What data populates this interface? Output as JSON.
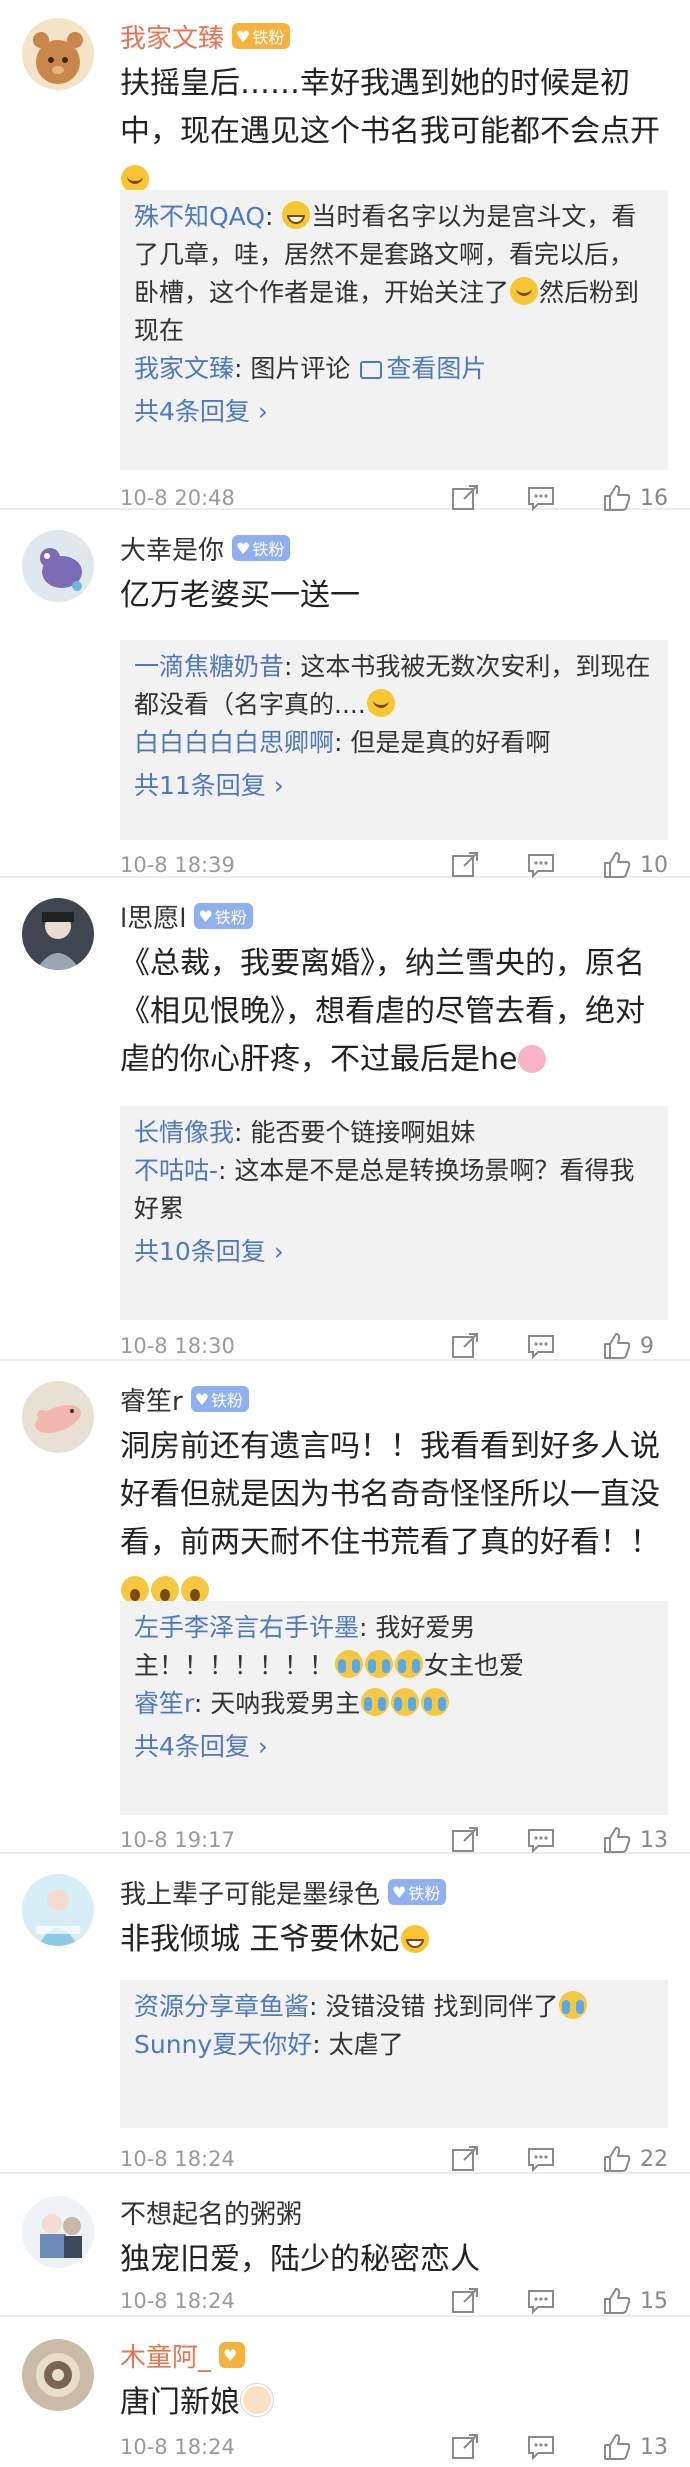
{
  "comments": [
    {
      "name": "我家文臻",
      "name_vip": true,
      "badge": "铁粉",
      "badge_style": "gold",
      "text_parts": [
        "扶摇皇后……幸好我遇到她的时候是初中，现在遇见这个书名我可能都不会点开"
      ],
      "emoji_end": "sweat",
      "replies": [
        {
          "name": "殊不知QAQ",
          "text": "当时看名字以为是宫斗文，看了几章，哇，居然不是套路文啊，看完以后，卧槽，这个作者是谁，开始关注了",
          "text2": "然后粉到现在"
        },
        {
          "name": "我家文臻",
          "text": "图片评论",
          "link": "查看图片"
        }
      ],
      "more": "共4条回复 ›",
      "time": "10-8 20:48",
      "likes": "16"
    },
    {
      "name": "大幸是你",
      "name_vip": false,
      "badge": "铁粉",
      "badge_style": "fan",
      "text_parts": [
        "亿万老婆买一送一"
      ],
      "replies": [
        {
          "name": "一滴焦糖奶昔",
          "text": "这本书我被无数次安利，到现在都没看（名字真的...."
        },
        {
          "name": "白白白白白思卿啊",
          "text": "但是是真的好看啊"
        }
      ],
      "more": "共11条回复 ›",
      "time": "10-8 18:39",
      "likes": "10"
    },
    {
      "name": "l思愿l",
      "name_vip": false,
      "badge": "铁粉",
      "badge_style": "fan",
      "text_parts": [
        "《总裁，我要离婚》，纳兰雪央的，原名《相见恨晚》，想看虐的尽管去看，绝对虐的你心肝疼，不过最后是he"
      ],
      "emoji_end": "pig",
      "replies": [
        {
          "name": "长情像我",
          "text": "能否要个链接啊姐妹"
        },
        {
          "name": "不咕咕-",
          "text": "这本是不是总是转换场景啊？看得我好累"
        }
      ],
      "more": "共10条回复 ›",
      "time": "10-8 18:30",
      "likes": "9"
    },
    {
      "name": "睿笙r",
      "name_vip": false,
      "badge": "铁粉",
      "badge_style": "fan",
      "text_parts": [
        "洞房前还有遗言吗！！我看看到好多人说好看但就是因为书名奇奇怪怪所以一直没看，前两天耐不住书荒看了真的好看！！"
      ],
      "emoji_end": "shock3",
      "replies": [
        {
          "name": "左手李泽言右手许墨",
          "text": "我好爱男主！！！！！！！",
          "text_after": "女主也爱"
        },
        {
          "name": "睿笙r",
          "text": "天呐我爱男主"
        }
      ],
      "more": "共4条回复 ›",
      "time": "10-8 19:17",
      "likes": "13"
    },
    {
      "name": "我上辈子可能是墨绿色",
      "name_vip": false,
      "badge": "铁粉",
      "badge_style": "fan",
      "text_parts": [
        "非我倾城 王爷要休妃"
      ],
      "emoji_end": "grin",
      "replies": [
        {
          "name": "资源分享章鱼酱",
          "text": "没错没错 找到同伴了"
        },
        {
          "name": "Sunny夏天你好",
          "text": "太虐了"
        }
      ],
      "time": "10-8 18:24",
      "likes": "22"
    },
    {
      "name": "不想起名的粥粥",
      "name_vip": false,
      "text_parts": [
        "独宠旧爱，陆少的秘密恋人"
      ],
      "time": "10-8 18:24",
      "likes": "15"
    },
    {
      "name": "木童阿_",
      "name_vip": true,
      "text_parts": [
        "唐门新娘"
      ],
      "emoji_end": "bride",
      "time": "10-8 18:24",
      "likes": "13"
    }
  ]
}
